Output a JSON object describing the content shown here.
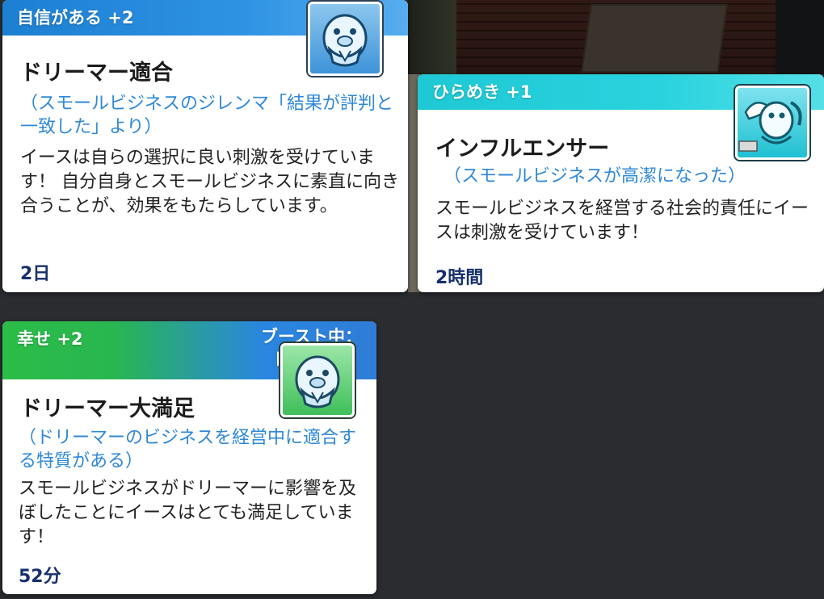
{
  "moodlets": [
    {
      "emotion": "自信がある +2",
      "title": "ドリーマー適合",
      "source": "（スモールビジネスのジレンマ「結果が評判と一致した」より）",
      "description": "イースは自らの選択に良い刺激を受けています！ 自分自身とスモールビジネスに素直に向き合うことが、効果をもたらしています。",
      "duration": "2日",
      "icon": "walrus-hands-clasped-icon",
      "header_color": "#2f93e4"
    },
    {
      "emotion": "ひらめき +1",
      "title": "インフルエンサー",
      "source": "（スモールビジネスが高潔になった）",
      "description": "スモールビジネスを経営する社会的責任にイースは刺激を受けています！",
      "duration": "2時間",
      "icon": "winged-seal-icon",
      "header_color": "#29d3de"
    },
    {
      "emotion": "幸せ +2",
      "boost_label": "ブースト中：",
      "boost_value": "自信",
      "title": "ドリーマー大満足",
      "source": "（ドリーマーのビジネスを経営中に適合する特質がある）",
      "description": "スモールビジネスがドリーマーに影響を及ぼしたことにイースはとても満足しています！",
      "duration": "52分",
      "icon": "walrus-hands-clasped-icon",
      "header_color": "#2bbd47"
    }
  ]
}
